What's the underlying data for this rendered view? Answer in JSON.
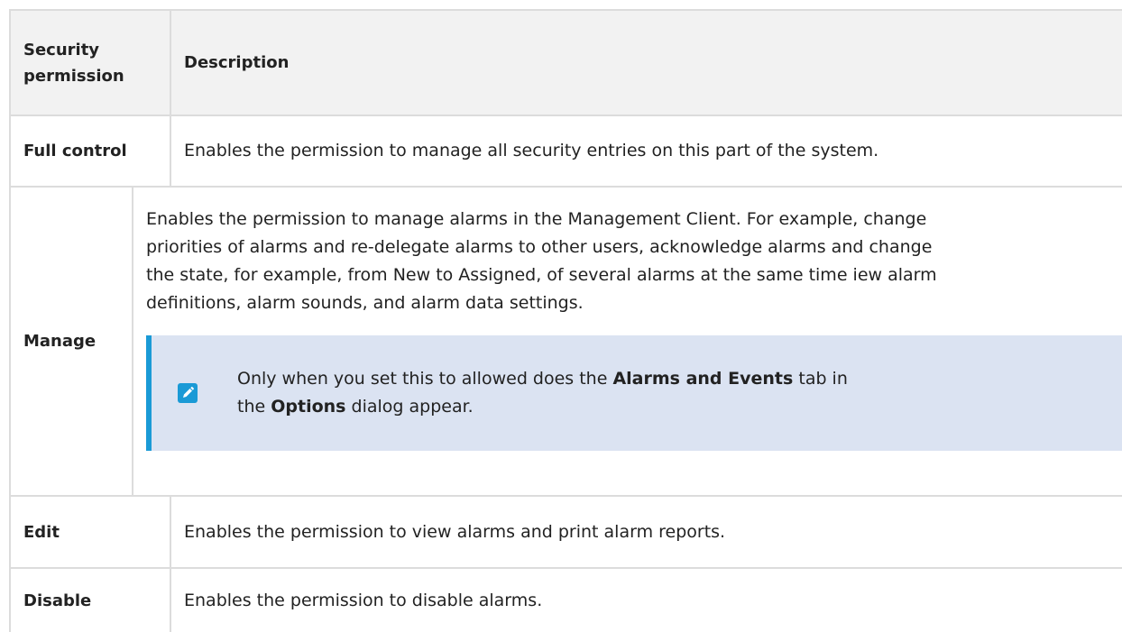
{
  "header": {
    "col1_line1": "Security",
    "col1_line2": "permission",
    "col2": "Description"
  },
  "rows": [
    {
      "permission": "Full control",
      "description": "Enables the permission to manage all security entries on this part of the system."
    },
    {
      "permission": "Manage",
      "description_lines": [
        "Enables the permission to manage alarms in the Management Client. For example, change",
        "priorities of alarms and re-delegate alarms to other users, acknowledge alarms and change",
        "the state, for example, from New to Assigned, of several alarms at the same time iew alarm",
        "definitions, alarm sounds, and alarm data settings."
      ],
      "note": {
        "icon": "pencil-icon",
        "line1_pre": "Only when you set this to allowed does the ",
        "line1_bold": "Alarms and Events",
        "line1_post": " tab in",
        "line2_pre": "the ",
        "line2_bold": "Options",
        "line2_post": " dialog appear."
      }
    },
    {
      "permission": "Edit",
      "description": "Enables the permission to view alarms and print alarm reports."
    },
    {
      "permission": "Disable",
      "description": "Enables the permission to disable alarms."
    }
  ],
  "colors": {
    "accent": "#1a9ad6",
    "note_bg": "#dbe3f2",
    "header_bg": "#f2f2f2",
    "border": "#dcdcdc"
  }
}
